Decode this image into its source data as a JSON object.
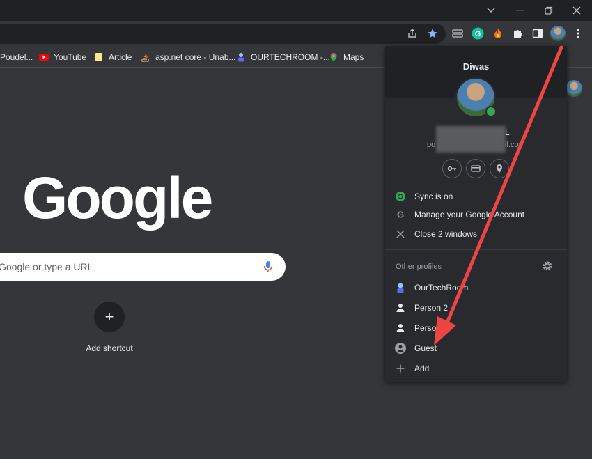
{
  "window": {
    "controls": [
      "chevron-down",
      "minimize",
      "restore",
      "close"
    ]
  },
  "toolbar": {
    "icons": [
      "share-icon",
      "bookmark-star-icon",
      "tab-search-icon",
      "grammarly-icon",
      "extension-fire-icon",
      "puzzle-icon",
      "side-panel-icon",
      "profile-avatar",
      "menu-dots-icon"
    ],
    "accent": "#8ab4f8"
  },
  "bookmarks": [
    {
      "label": "Poudel...",
      "icon": "generic"
    },
    {
      "label": "YouTube",
      "icon": "youtube"
    },
    {
      "label": "Article",
      "icon": "folder"
    },
    {
      "label": "asp.net core - Unab...",
      "icon": "stackoverflow"
    },
    {
      "label": "OURTECHROOM -...",
      "icon": "person"
    },
    {
      "label": "Maps",
      "icon": "maps"
    }
  ],
  "ntp": {
    "logo": "Google",
    "search_placeholder": "Google or type a URL",
    "shortcut_label": "Add shortcut",
    "shortcut_symbol": "+"
  },
  "profile_menu": {
    "name": "Diwas",
    "email_suffix_initial": "L",
    "email_prefix": "po",
    "email_domain": "il.com",
    "items": [
      {
        "label": "Sync is on",
        "icon": "sync-icon"
      },
      {
        "label": "Manage your Google Account",
        "icon": "google-g-icon"
      },
      {
        "label": "Close 2 windows",
        "icon": "close-x-icon"
      }
    ],
    "other_profiles_label": "Other profiles",
    "profiles": [
      {
        "label": "OurTechRoom",
        "icon": "custom-avatar-icon"
      },
      {
        "label": "Person 2",
        "icon": "person-icon"
      },
      {
        "label": "Person 3",
        "icon": "person-icon"
      },
      {
        "label": "Guest",
        "icon": "guest-icon"
      },
      {
        "label": "Add",
        "icon": "plus-icon"
      }
    ]
  },
  "annotation": {
    "arrow_color": "#ef4444"
  }
}
